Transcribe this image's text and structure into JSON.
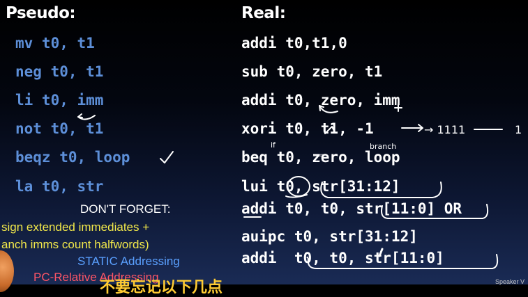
{
  "headers": {
    "pseudo": "Pseudo:",
    "real": "Real:"
  },
  "rows": [
    {
      "pseudo": "mv t0, t1",
      "real": "addi t0,t1,0"
    },
    {
      "pseudo": "neg t0, t1",
      "real": "sub t0, zero, t1"
    },
    {
      "pseudo": "li t0, imm",
      "real": "addi t0, zero, imm"
    },
    {
      "pseudo": "not t0, t1",
      "real": "xori t0, t1, -1"
    },
    {
      "pseudo": "beqz t0, loop",
      "real": "beq t0, zero, loop"
    },
    {
      "pseudo": "la t0, str",
      "real": "lui t0, str[31:12]"
    }
  ],
  "real_extra": [
    "addi t0, t0, str[11:0] OR",
    "auipc t0, str[31:12]",
    "addi  t0, t0, str[11:0]"
  ],
  "notes": {
    "dont_forget": "DON'T FORGET:",
    "sign_ext": "sign extended immediates +",
    "halfwords": "anch imms count halfwords)",
    "static": "STATIC Addressing",
    "pc_rel": "PC-Relative Addressing"
  },
  "handwriting": {
    "ones": "→ 1111",
    "one": "1",
    "if": "if",
    "branch": "branch",
    "eqeq": "=="
  },
  "subtitle": "不要忘记以下几点",
  "corner_text": "Speaker V",
  "colors": {
    "pseudo_text": "#5d8fd8",
    "real_text": "#ffffff",
    "dont_forget": "#ffffff",
    "sign_ext": "#f2e84a",
    "halfwords": "#f2e84a",
    "static": "#5aa0ff",
    "pc_rel": "#ff5566",
    "subtitle": "#ffcc33"
  }
}
